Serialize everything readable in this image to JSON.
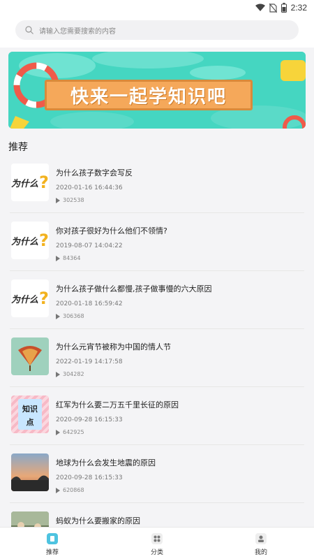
{
  "status_bar": {
    "time": "2:32"
  },
  "search": {
    "placeholder": "请输入您需要搜索的内容"
  },
  "banner": {
    "text": "快来一起学知识吧"
  },
  "section": {
    "title": "推荐"
  },
  "thumb_text": {
    "why": "为什么",
    "knowledge": "知识点"
  },
  "items": [
    {
      "title": "为什么孩子数字会写反",
      "date": "2020-01-16 16:44:36",
      "views": "302538",
      "thumb": "why"
    },
    {
      "title": "你对孩子很好为什么他们不领情?",
      "date": "2019-08-07 14:04:22",
      "views": "84364",
      "thumb": "why"
    },
    {
      "title": "为什么孩子做什么都慢,孩子做事慢的六大原因",
      "date": "2020-01-18 16:59:42",
      "views": "306368",
      "thumb": "why"
    },
    {
      "title": "为什么元宵节被称为中国的情人节",
      "date": "2022-01-19 14:17:58",
      "views": "304282",
      "thumb": "fan"
    },
    {
      "title": "红军为什么要二万五千里长征的原因",
      "date": "2020-09-28 16:15:33",
      "views": "642925",
      "thumb": "knowledge"
    },
    {
      "title": "地球为什么会发生地震的原因",
      "date": "2020-09-28 16:15:33",
      "views": "620868",
      "thumb": "sunset"
    },
    {
      "title": "蚂蚁为什么要搬家的原因",
      "date": "",
      "views": "",
      "thumb": "people"
    }
  ],
  "nav": [
    {
      "label": "推荐",
      "icon": "recommend-icon"
    },
    {
      "label": "分类",
      "icon": "category-icon"
    },
    {
      "label": "我的",
      "icon": "profile-icon"
    }
  ],
  "colors": {
    "accent": "#4ec3e0",
    "banner_bg": "#45d6c1",
    "banner_board": "#f5a85a"
  }
}
